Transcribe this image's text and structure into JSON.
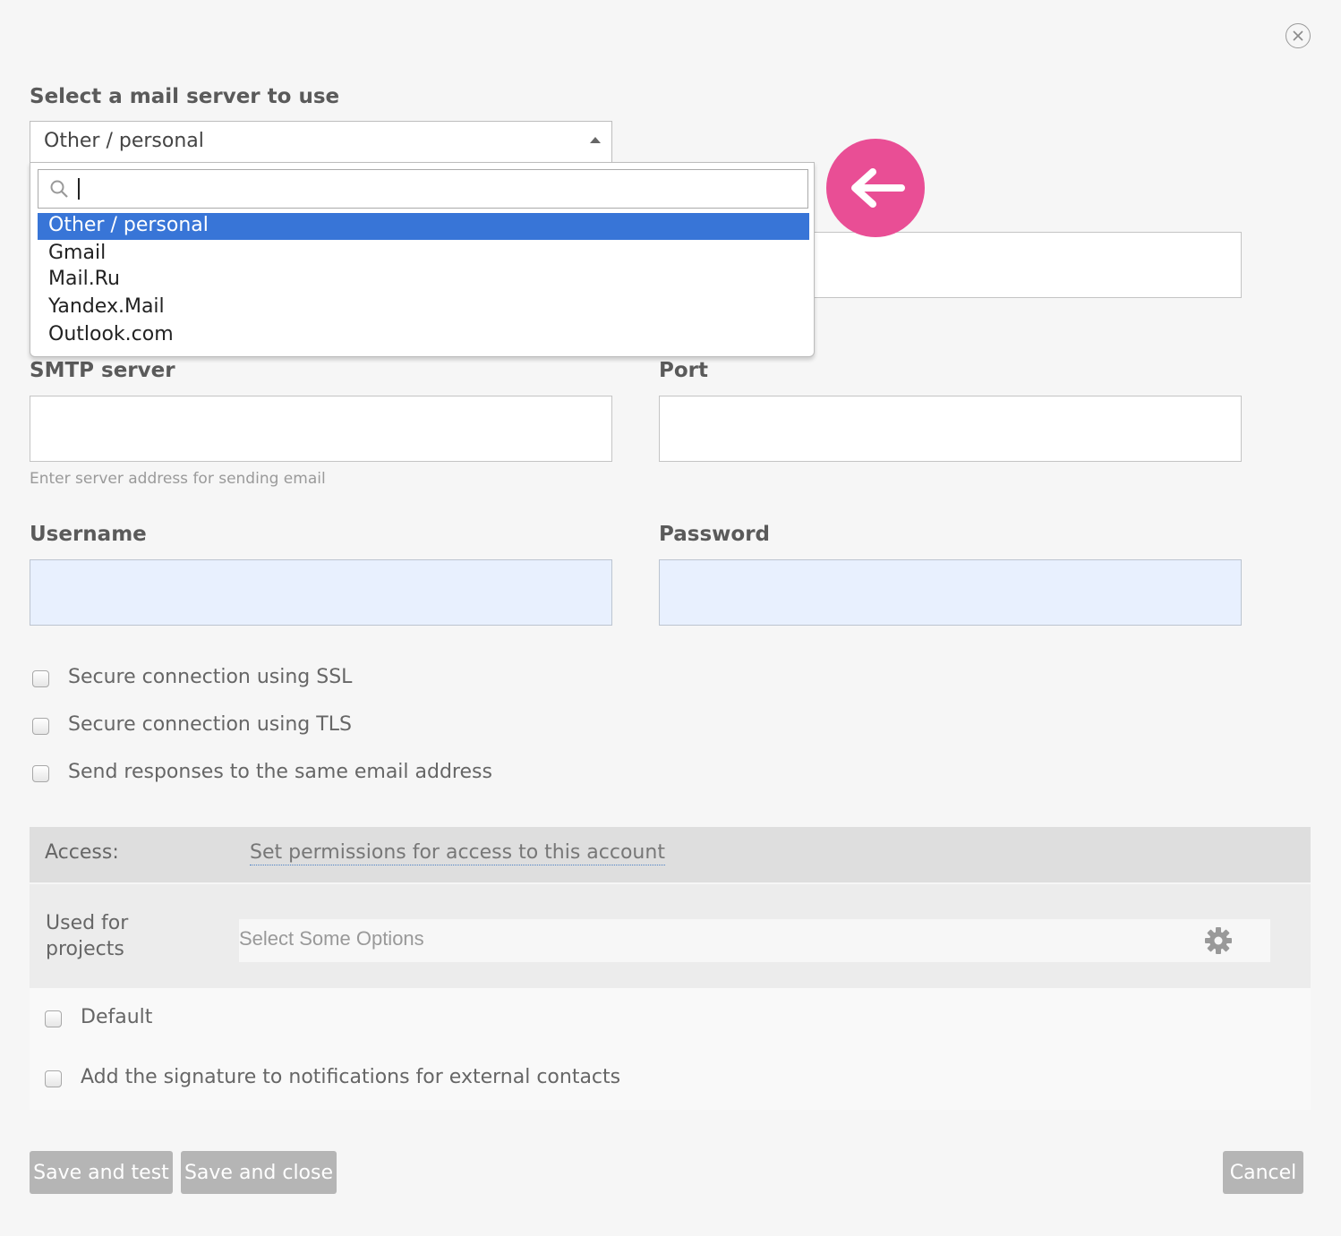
{
  "server_select": {
    "label": "Select a mail server to use",
    "value": "Other / personal",
    "search_value": "",
    "options": [
      "Other / personal",
      "Gmail",
      "Mail.Ru",
      "Yandex.Mail",
      "Outlook.com"
    ],
    "selected_index": 0
  },
  "smtp": {
    "label": "SMTP server",
    "value": "",
    "hint": "Enter server address for sending email"
  },
  "port": {
    "label": "Port",
    "value": ""
  },
  "username": {
    "label": "Username",
    "value": ""
  },
  "password": {
    "label": "Password",
    "value": ""
  },
  "security_options": [
    {
      "label": "Secure connection using SSL",
      "checked": false
    },
    {
      "label": "Secure connection using TLS",
      "checked": false
    },
    {
      "label": "Send responses to the same email address",
      "checked": false
    }
  ],
  "access": {
    "label": "Access:",
    "link": "Set permissions for access to this account"
  },
  "projects": {
    "label_line1": "Used for",
    "label_line2": "projects",
    "placeholder": "Select Some Options"
  },
  "extra_options": [
    {
      "label": "Default",
      "checked": false
    },
    {
      "label": "Add the signature to notifications for external contacts",
      "checked": false
    }
  ],
  "buttons": {
    "save_test": "Save and test",
    "save_close": "Save and close",
    "cancel": "Cancel"
  },
  "colors": {
    "highlight": "#3875d7",
    "annotation_arrow": "#e94e95",
    "button_bg": "#b5b5b5",
    "autofill_bg": "#e8f0fe"
  },
  "icons": {
    "close": "close-circle-icon",
    "search": "search-icon",
    "settings": "gear-icon",
    "annotation": "arrow-left-icon"
  }
}
